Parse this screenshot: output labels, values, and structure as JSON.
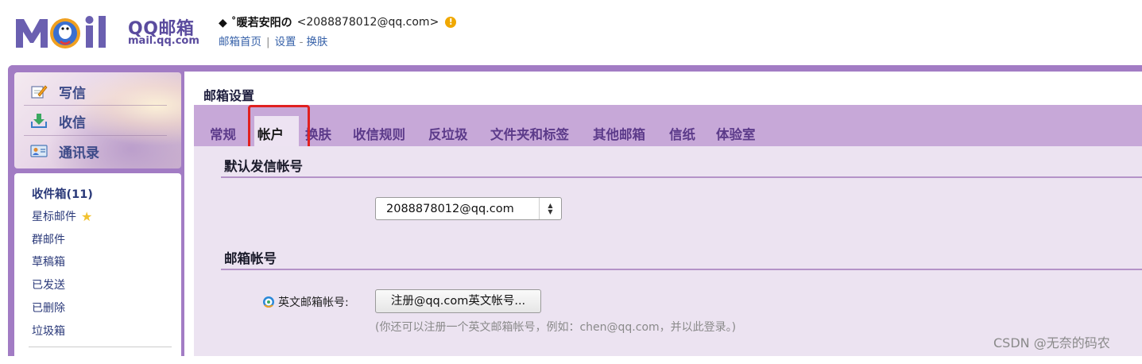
{
  "header": {
    "brand_name": "QQ邮箱",
    "brand_domain": "mail.qq.com",
    "user_nickname": "◆ ˚暖若安阳の",
    "user_email": "<2088878012@qq.com>",
    "warning_glyph": "!",
    "links": {
      "home": "邮箱首页",
      "sep": "|",
      "settings": "设置",
      "dash": "-",
      "skin": "换肤"
    }
  },
  "sidebar": {
    "quick": [
      {
        "label": "写信",
        "icon": "compose-icon"
      },
      {
        "label": "收信",
        "icon": "inbox-download-icon"
      },
      {
        "label": "通讯录",
        "icon": "contacts-icon"
      }
    ],
    "folders": [
      {
        "label": "收件箱(11)"
      },
      {
        "label": "星标邮件"
      },
      {
        "label": "群邮件"
      },
      {
        "label": "草稿箱"
      },
      {
        "label": "已发送"
      },
      {
        "label": "已删除"
      },
      {
        "label": "垃圾箱"
      }
    ]
  },
  "main": {
    "page_title": "邮箱设置",
    "tabs": [
      {
        "label": "常规"
      },
      {
        "label": "帐户"
      },
      {
        "label": "换肤"
      },
      {
        "label": "收信规则"
      },
      {
        "label": "反垃圾"
      },
      {
        "label": "文件夹和标签"
      },
      {
        "label": "其他邮箱"
      },
      {
        "label": "信纸"
      },
      {
        "label": "体验室"
      }
    ],
    "active_tab": "帐户",
    "sections": {
      "default_sender_title": "默认发信帐号",
      "default_sender_value": "2088878012@qq.com",
      "mailbox_accounts_title": "邮箱帐号",
      "english_account_label": "英文邮箱帐号:",
      "register_button": "注册@qq.com英文帐号...",
      "hint": "(你还可以注册一个英文邮箱帐号，例如：chen@qq.com，并以此登录。)"
    }
  },
  "watermark": "CSDN @无奈的码农",
  "colors": {
    "frame": "#a27cc4",
    "tabbar": "#c7a8d8",
    "content_bg": "#ece3f1",
    "tab_text": "#5c3b8a",
    "highlight_box": "#e02020"
  }
}
